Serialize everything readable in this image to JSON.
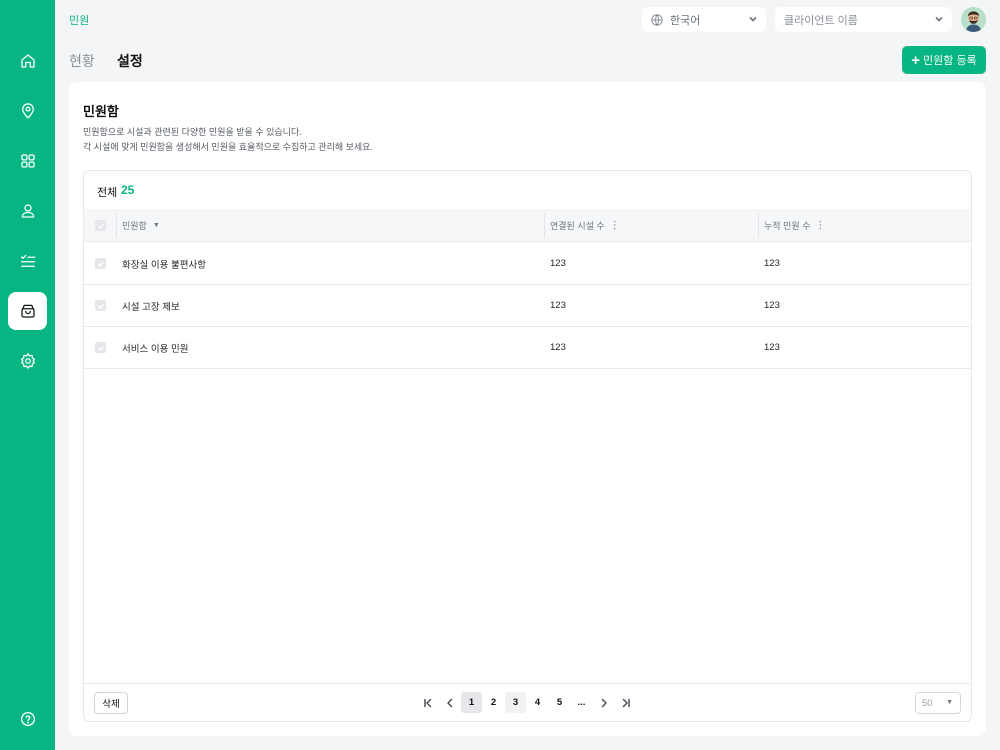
{
  "app": {
    "breadcrumb": "민원",
    "brand_color": "#06b581"
  },
  "sidebar": {
    "items": [
      {
        "icon": "home-icon"
      },
      {
        "icon": "location-pin-icon"
      },
      {
        "icon": "grid-icon"
      },
      {
        "icon": "user-icon"
      },
      {
        "icon": "checklist-icon"
      },
      {
        "icon": "inbox-icon",
        "active": true
      },
      {
        "icon": "gear-icon"
      }
    ],
    "help_icon": "help-circle-icon"
  },
  "header": {
    "language": "한국어",
    "client_placeholder": "클라이언트 이름"
  },
  "tabs": [
    {
      "label": "현황",
      "active": false
    },
    {
      "label": "설정",
      "active": true
    }
  ],
  "actions": {
    "add_label": "민원함 등록"
  },
  "card": {
    "title": "민원함",
    "description_line1": "민원함으로 시설과 관련된 다양한 민원을 받을 수 있습니다.",
    "description_line2": "각 시설에 맞게 민원함을 생성해서 민원을 효율적으로 수집하고 관리해 보세요."
  },
  "table": {
    "total_label": "전체",
    "total_count": "25",
    "columns": [
      "민원함",
      "연결된 시설 수",
      "누적 민원 수"
    ],
    "rows": [
      {
        "name": "화장실 이용 불편사항",
        "facilities": "123",
        "complaints": "123"
      },
      {
        "name": "시설 고장 제보",
        "facilities": "123",
        "complaints": "123"
      },
      {
        "name": "서비스 이용 민원",
        "facilities": "123",
        "complaints": "123"
      }
    ]
  },
  "footer": {
    "delete_label": "삭제",
    "pages": [
      "1",
      "2",
      "3",
      "4",
      "5"
    ],
    "ellipsis": "...",
    "current_page": "1",
    "per_page": "50"
  }
}
